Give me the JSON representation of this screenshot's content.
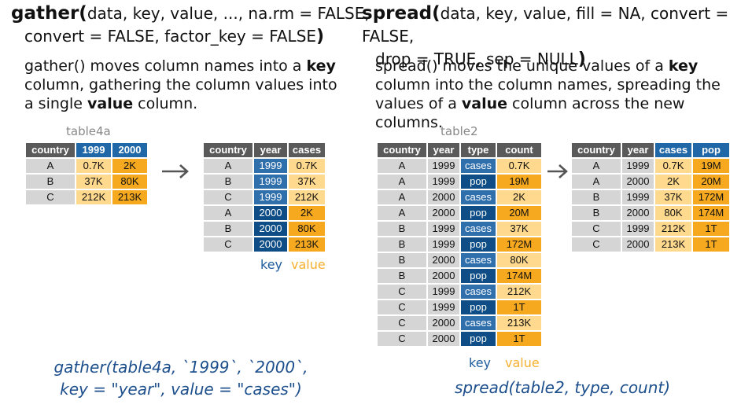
{
  "gather": {
    "signature": {
      "name": "gather(",
      "args_line1": "data, key, value, ..., na.rm = FALSE,",
      "args_line2": "convert = FALSE, factor_key = FALSE",
      "close": ")"
    },
    "description": {
      "p1": "gather() moves column names into a ",
      "k1": "key",
      "p2": " column, gathering the column values into a single ",
      "k2": "value",
      "p3": " column."
    },
    "input_table": {
      "name": "table4a",
      "headers": [
        "country",
        "1999",
        "2000"
      ],
      "rows": [
        [
          "A",
          "0.7K",
          "2K"
        ],
        [
          "B",
          "37K",
          "80K"
        ],
        [
          "C",
          "212K",
          "213K"
        ]
      ]
    },
    "output_table": {
      "headers": [
        "country",
        "year",
        "cases"
      ],
      "rows": [
        [
          "A",
          "1999",
          "0.7K"
        ],
        [
          "B",
          "1999",
          "37K"
        ],
        [
          "C",
          "1999",
          "212K"
        ],
        [
          "A",
          "2000",
          "2K"
        ],
        [
          "B",
          "2000",
          "80K"
        ],
        [
          "C",
          "2000",
          "213K"
        ]
      ]
    },
    "key_label": "key",
    "value_label": "value",
    "call_line1": "gather(table4a, `1999`, `2000`,",
    "call_line2": "key = \"year\", value = \"cases\")"
  },
  "spread": {
    "signature": {
      "name": "spread(",
      "args_line1": "data, key, value, fill = NA, convert = FALSE,",
      "args_line2": "drop = TRUE, sep = NULL",
      "close": ")"
    },
    "description": {
      "p1": "spread() moves the unique values of a ",
      "k1": "key",
      "p2": " column into the column names, spreading the values of a ",
      "k2": "value",
      "p3": " column across the new columns."
    },
    "input_table": {
      "name": "table2",
      "headers": [
        "country",
        "year",
        "type",
        "count"
      ],
      "rows": [
        [
          "A",
          "1999",
          "cases",
          "0.7K"
        ],
        [
          "A",
          "1999",
          "pop",
          "19M"
        ],
        [
          "A",
          "2000",
          "cases",
          "2K"
        ],
        [
          "A",
          "2000",
          "pop",
          "20M"
        ],
        [
          "B",
          "1999",
          "cases",
          "37K"
        ],
        [
          "B",
          "1999",
          "pop",
          "172M"
        ],
        [
          "B",
          "2000",
          "cases",
          "80K"
        ],
        [
          "B",
          "2000",
          "pop",
          "174M"
        ],
        [
          "C",
          "1999",
          "cases",
          "212K"
        ],
        [
          "C",
          "1999",
          "pop",
          "1T"
        ],
        [
          "C",
          "2000",
          "cases",
          "213K"
        ],
        [
          "C",
          "2000",
          "pop",
          "1T"
        ]
      ]
    },
    "output_table": {
      "headers": [
        "country",
        "year",
        "cases",
        "pop"
      ],
      "rows": [
        [
          "A",
          "1999",
          "0.7K",
          "19M"
        ],
        [
          "A",
          "2000",
          "2K",
          "20M"
        ],
        [
          "B",
          "1999",
          "37K",
          "172M"
        ],
        [
          "B",
          "2000",
          "80K",
          "174M"
        ],
        [
          "C",
          "1999",
          "212K",
          "1T"
        ],
        [
          "C",
          "2000",
          "213K",
          "1T"
        ]
      ]
    },
    "key_label": "key",
    "value_label": "value",
    "call": "spread(table2, type, count)"
  },
  "colors": {
    "header_gray": "#5a5a5a",
    "header_blue": "#2067a8",
    "cell_gray": "#d5d5d5",
    "cell_light_yellow": "#ffd98d",
    "cell_gold": "#f6a91f",
    "cell_light_blue": "#2f6fac",
    "cell_dark_blue": "#0e4d86",
    "call_text": "#1d4f8c"
  },
  "icons": {
    "transform_arrow": "arrow-right-icon"
  }
}
